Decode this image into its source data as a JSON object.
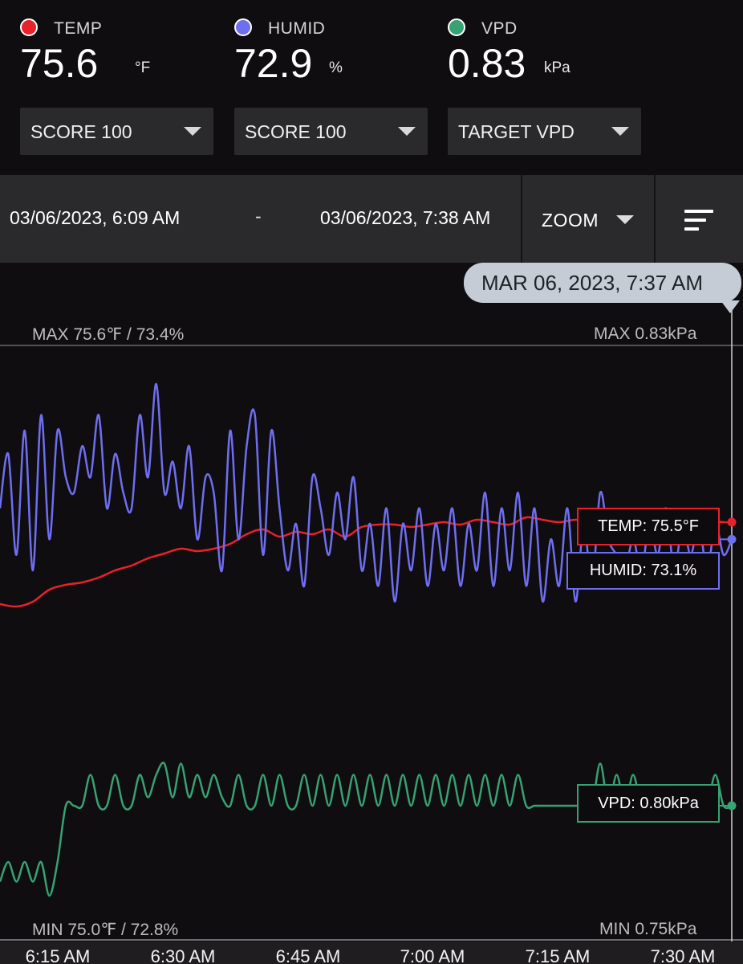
{
  "metrics": [
    {
      "label": "TEMP",
      "value": "75.6",
      "unit": "°F",
      "color": "#e8212b"
    },
    {
      "label": "HUMID",
      "value": "72.9",
      "unit": "%",
      "color": "#6e6ef0"
    },
    {
      "label": "VPD",
      "value": "0.83",
      "unit": "kPa",
      "color": "#37a273"
    }
  ],
  "dropdowns": [
    {
      "label": "SCORE 100"
    },
    {
      "label": "SCORE 100"
    },
    {
      "label": "TARGET VPD"
    }
  ],
  "range": {
    "start": "03/06/2023, 6:09 AM",
    "separator": "-",
    "end": "03/06/2023, 7:38 AM",
    "zoom_label": "ZOOM"
  },
  "cursor": {
    "tooltip": "MAR 06, 2023, 7:37 AM",
    "temp_tag": "TEMP: 75.5°F",
    "humid_tag": "HUMID: 73.1%",
    "vpd_tag": "VPD: 0.80kPa"
  },
  "chart_data": {
    "type": "line",
    "max_left": "MAX 75.6℉ / 73.4%",
    "max_right": "MAX 0.83kPa",
    "min_left": "MIN 75.0℉ / 72.8%",
    "min_right": "MIN 0.75kPa",
    "x_ticks": [
      "6:15 AM",
      "6:30 AM",
      "6:45 AM",
      "7:00 AM",
      "7:15 AM",
      "7:30 AM"
    ],
    "time_range_min": [
      0,
      89
    ],
    "temp_range": [
      75.0,
      75.6
    ],
    "humid_range": [
      72.8,
      73.4
    ],
    "vpd_range": [
      0.75,
      0.83
    ],
    "series": [
      {
        "name": "TEMP",
        "color": "#e8212b",
        "x": [
          0,
          2,
          4,
          6,
          8,
          10,
          12,
          14,
          16,
          18,
          20,
          22,
          24,
          26,
          28,
          30,
          32,
          34,
          36,
          38,
          40,
          42,
          44,
          46,
          48,
          50,
          52,
          54,
          56,
          58,
          60,
          62,
          64,
          66,
          68,
          70,
          72,
          74,
          76,
          78,
          80,
          82,
          84,
          86,
          88,
          89
        ],
        "values": [
          75.16,
          75.15,
          75.17,
          75.22,
          75.24,
          75.25,
          75.27,
          75.3,
          75.32,
          75.35,
          75.37,
          75.39,
          75.38,
          75.39,
          75.41,
          75.45,
          75.47,
          75.44,
          75.46,
          75.45,
          75.47,
          75.44,
          75.48,
          75.49,
          75.49,
          75.48,
          75.49,
          75.5,
          75.49,
          75.51,
          75.5,
          75.49,
          75.52,
          75.51,
          75.5,
          75.51,
          75.5,
          75.52,
          75.52,
          75.51,
          75.52,
          75.51,
          75.52,
          75.51,
          75.5,
          75.5
        ]
      },
      {
        "name": "HUMID",
        "color": "#6e6ef0",
        "x": [
          0,
          1,
          2,
          3,
          4,
          5,
          6,
          7,
          8,
          9,
          10,
          11,
          12,
          13,
          14,
          15,
          16,
          17,
          18,
          19,
          20,
          21,
          22,
          23,
          24,
          25,
          26,
          27,
          28,
          29,
          30,
          31,
          32,
          33,
          34,
          35,
          36,
          37,
          38,
          39,
          40,
          41,
          42,
          43,
          44,
          45,
          46,
          47,
          48,
          49,
          50,
          51,
          52,
          53,
          54,
          55,
          56,
          57,
          58,
          59,
          60,
          61,
          62,
          63,
          64,
          65,
          66,
          67,
          68,
          69,
          70,
          71,
          72,
          73,
          74,
          75,
          76,
          77,
          78,
          79,
          80,
          81,
          82,
          83,
          84,
          85,
          86,
          87,
          88,
          89
        ],
        "values": [
          73.18,
          73.25,
          73.12,
          73.28,
          73.1,
          73.3,
          73.14,
          73.28,
          73.22,
          73.2,
          73.26,
          73.22,
          73.3,
          73.18,
          73.25,
          73.2,
          73.18,
          73.3,
          73.22,
          73.34,
          73.2,
          73.24,
          73.18,
          73.26,
          73.14,
          73.22,
          73.2,
          73.1,
          73.28,
          73.14,
          73.26,
          73.3,
          73.12,
          73.28,
          73.18,
          73.1,
          73.16,
          73.08,
          73.22,
          73.18,
          73.12,
          73.2,
          73.14,
          73.22,
          73.1,
          73.16,
          73.08,
          73.18,
          73.06,
          73.16,
          73.1,
          73.18,
          73.08,
          73.16,
          73.1,
          73.18,
          73.08,
          73.16,
          73.1,
          73.2,
          73.08,
          73.18,
          73.1,
          73.2,
          73.08,
          73.18,
          73.06,
          73.14,
          73.08,
          73.18,
          73.06,
          73.16,
          73.08,
          73.2,
          73.14,
          73.12,
          73.1,
          73.14,
          73.1,
          73.16,
          73.12,
          73.18,
          73.1,
          73.16,
          73.12,
          73.16,
          73.1,
          73.16,
          73.12,
          73.14
        ]
      },
      {
        "name": "VPD",
        "color": "#37a273",
        "x": [
          0,
          1,
          2,
          3,
          4,
          5,
          6,
          7,
          8,
          9,
          10,
          11,
          12,
          13,
          14,
          15,
          16,
          17,
          18,
          19,
          20,
          21,
          22,
          23,
          24,
          25,
          26,
          27,
          28,
          29,
          30,
          31,
          32,
          33,
          34,
          35,
          36,
          37,
          38,
          39,
          40,
          41,
          42,
          43,
          44,
          45,
          46,
          47,
          48,
          49,
          50,
          51,
          52,
          53,
          54,
          55,
          56,
          57,
          58,
          59,
          60,
          61,
          62,
          63,
          64,
          65,
          66,
          67,
          68,
          69,
          70,
          71,
          72,
          73,
          74,
          75,
          76,
          77,
          78,
          79,
          80,
          81,
          82,
          83,
          84,
          85,
          86,
          87,
          88,
          89
        ],
        "values": [
          0.765,
          0.772,
          0.765,
          0.772,
          0.765,
          0.772,
          0.76,
          0.772,
          0.792,
          0.792,
          0.792,
          0.803,
          0.792,
          0.792,
          0.803,
          0.792,
          0.792,
          0.803,
          0.795,
          0.803,
          0.807,
          0.795,
          0.807,
          0.795,
          0.803,
          0.795,
          0.803,
          0.795,
          0.792,
          0.803,
          0.792,
          0.792,
          0.803,
          0.792,
          0.803,
          0.792,
          0.792,
          0.803,
          0.792,
          0.803,
          0.792,
          0.803,
          0.792,
          0.803,
          0.792,
          0.803,
          0.792,
          0.803,
          0.792,
          0.803,
          0.792,
          0.803,
          0.792,
          0.803,
          0.792,
          0.803,
          0.792,
          0.803,
          0.792,
          0.803,
          0.792,
          0.803,
          0.792,
          0.803,
          0.792,
          0.792,
          0.792,
          0.792,
          0.792,
          0.792,
          0.792,
          0.792,
          0.792,
          0.807,
          0.792,
          0.803,
          0.792,
          0.803,
          0.792,
          0.792,
          0.792,
          0.792,
          0.792,
          0.792,
          0.792,
          0.792,
          0.792,
          0.803,
          0.792,
          0.792
        ]
      }
    ]
  }
}
